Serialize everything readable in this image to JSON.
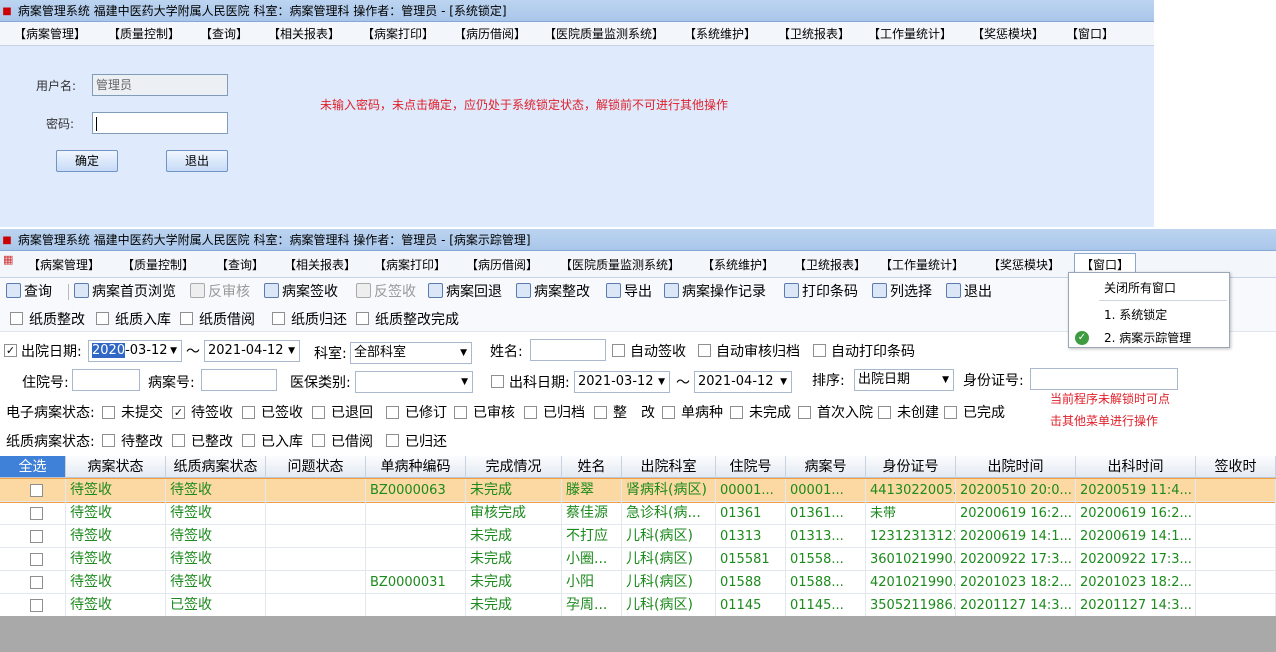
{
  "top_window": {
    "title": "病案管理系统  福建中医药大学附属人民医院  科室：病案管理科  操作者：管理员 - [系统锁定]",
    "menu": [
      "【病案管理】",
      "【质量控制】",
      "【查询】",
      "【相关报表】",
      "【病案打印】",
      "【病历借阅】",
      "【医院质量监测系统】",
      "【系统维护】",
      "【卫统报表】",
      "【工作量统计】",
      "【奖惩模块】",
      "【窗口】"
    ],
    "lock_form": {
      "username_label": "用户名:",
      "username_value": "管理员",
      "password_label": "密码:",
      "password_value": "",
      "ok_label": "确定",
      "exit_label": "退出"
    },
    "annotation": "未输入密码，未点击确定，应仍处于系统锁定状态，解锁前不可进行其他操作"
  },
  "main_window": {
    "title": "病案管理系统  福建中医药大学附属人民医院  科室：病案管理科  操作者：管理员 - [病案示踪管理]",
    "menu": [
      "【病案管理】",
      "【质量控制】",
      "【查询】",
      "【相关报表】",
      "【病案打印】",
      "【病历借阅】",
      "【医院质量监测系统】",
      "【系统维护】",
      "【卫统报表】",
      "【工作量统计】",
      "【奖惩模块】",
      "【窗口】"
    ],
    "window_menu_popup": {
      "items": [
        "关闭所有窗口",
        "1. 系统锁定",
        "2. 病案示踪管理"
      ],
      "checked_index": 2
    },
    "toolbar": [
      {
        "label": "查询",
        "icon": "search-icon",
        "enabled": true
      },
      {
        "label": "病案首页浏览",
        "icon": "browse-icon",
        "enabled": true
      },
      {
        "label": "反审核",
        "icon": "unaudit-icon",
        "enabled": false
      },
      {
        "label": "病案签收",
        "icon": "sign-icon",
        "enabled": true
      },
      {
        "label": "反签收",
        "icon": "unsign-icon",
        "enabled": false
      },
      {
        "label": "病案回退",
        "icon": "return-icon",
        "enabled": true
      },
      {
        "label": "病案整改",
        "icon": "rectify-icon",
        "enabled": true
      },
      {
        "label": "导出",
        "icon": "export-icon",
        "enabled": true
      },
      {
        "label": "病案操作记录",
        "icon": "log-icon",
        "enabled": true
      },
      {
        "label": "打印条码",
        "icon": "print-icon",
        "enabled": true
      },
      {
        "label": "列选择",
        "icon": "columns-icon",
        "enabled": true
      },
      {
        "label": "退出",
        "icon": "exit-icon",
        "enabled": true
      }
    ],
    "paper_checks": [
      "纸质整改",
      "纸质入库",
      "纸质借阅",
      "纸质归还",
      "纸质整改完成"
    ],
    "filters": {
      "discharge_date_label": "出院日期:",
      "discharge_date_from_year": "2020",
      "discharge_date_from_rest": "-03-12",
      "tilde": "～",
      "discharge_date_to": "2021-04-12",
      "dept_label": "科室:",
      "dept_value": "全部科室",
      "name_label": "姓名:",
      "name_value": "",
      "auto_sign": "自动签收",
      "auto_audit": "自动审核归档",
      "auto_print": "自动打印条码",
      "inpatient_no_label": "住院号:",
      "record_no_label": "病案号:",
      "insurance_label": "医保类别:",
      "insurance_value": "",
      "out_date_label": "出科日期:",
      "out_date_from": "2021-03-12",
      "out_date_to": "2021-04-12",
      "sort_label": "排序:",
      "sort_value": "出院日期",
      "id_card_label": "身份证号:",
      "e_status_label": "电子病案状态:",
      "e_status_options": [
        "未提交",
        "待签收",
        "已签收",
        "已退回",
        "已修订",
        "已审核",
        "已归档",
        "整　改",
        "单病种",
        "未完成",
        "首次入院",
        "未创建",
        "已完成"
      ],
      "e_status_checked": [
        1
      ],
      "paper_status_label": "纸质病案状态:",
      "paper_status_options": [
        "待整改",
        "已整改",
        "已入库",
        "已借阅",
        "已归还"
      ]
    },
    "annotation": "当前程序未解锁时可点击其他菜单进行操作",
    "table": {
      "columns": [
        "全选",
        "病案状态",
        "纸质病案状态",
        "问题状态",
        "单病种编码",
        "完成情况",
        "姓名",
        "出院科室",
        "住院号",
        "病案号",
        "身份证号",
        "出院时间",
        "出科时间",
        "签收时"
      ],
      "rows": [
        [
          "",
          "待签收",
          "待签收",
          "",
          "BZ0000063",
          "未完成",
          "滕翠",
          "肾病科(病区)",
          "00001...",
          "00001...",
          "4413022005...",
          "20200510 20:0...",
          "20200519 11:4..."
        ],
        [
          "",
          "待签收",
          "待签收",
          "",
          "",
          "审核完成",
          "蔡佳源",
          "急诊科(病...",
          "01361",
          "01361...",
          "未带",
          "20200619 16:2...",
          "20200619 16:2..."
        ],
        [
          "",
          "待签收",
          "待签收",
          "",
          "",
          "未完成",
          "不打应",
          "儿科(病区)",
          "01313",
          "01313...",
          "123123131231",
          "20200619 14:1...",
          "20200619 14:1..."
        ],
        [
          "",
          "待签收",
          "待签收",
          "",
          "",
          "未完成",
          "小圈...",
          "儿科(病区)",
          "015581",
          "01558...",
          "3601021990...",
          "20200922 17:3...",
          "20200922 17:3..."
        ],
        [
          "",
          "待签收",
          "待签收",
          "",
          "BZ0000031",
          "未完成",
          "小阳",
          "儿科(病区)",
          "01588",
          "01588...",
          "4201021990...",
          "20201023 18:2...",
          "20201023 18:2..."
        ],
        [
          "",
          "待签收",
          "已签收",
          "",
          "",
          "未完成",
          "孕周...",
          "儿科(病区)",
          "01145",
          "01145...",
          "3505211986...",
          "20201127 14:3...",
          "20201127 14:3..."
        ]
      ]
    }
  }
}
